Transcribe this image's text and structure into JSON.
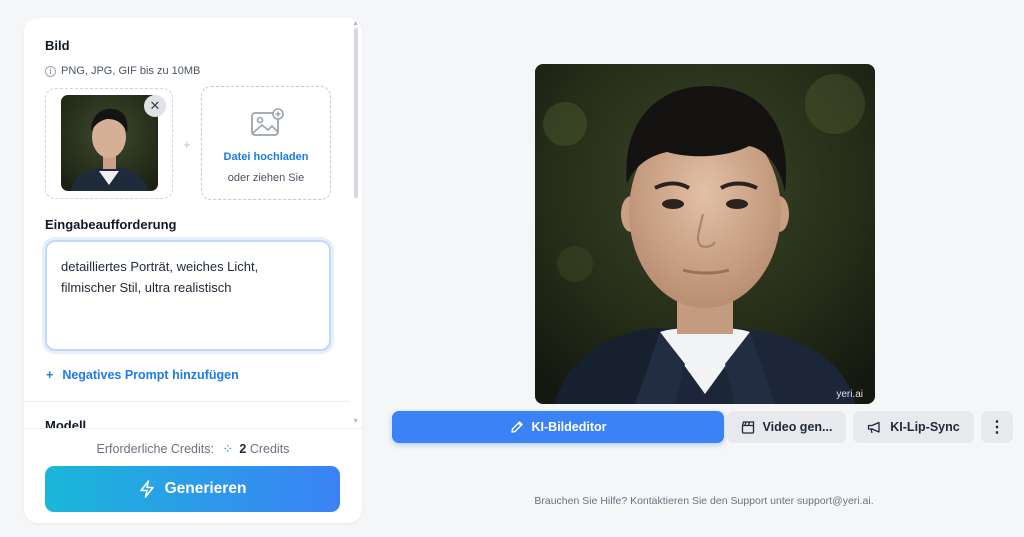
{
  "image_section": {
    "title": "Bild",
    "hint": "PNG, JPG, GIF bis zu 10MB",
    "upload_label": "Datei hochladen",
    "upload_sub": "oder ziehen Sie",
    "separator": "+",
    "remove": "✕"
  },
  "prompt_section": {
    "title": "Eingabeaufforderung",
    "value": "detailliertes Porträt, weiches Licht, filmischer Stil, ultra realistisch",
    "negative_link": "Negatives Prompt hinzufügen",
    "negative_plus": "+"
  },
  "model_section": {
    "title": "Modell"
  },
  "credits": {
    "label": "Erforderliche Credits:",
    "count": "2",
    "unit": "Credits"
  },
  "generate_button": "Generieren",
  "preview": {
    "watermark": "yeri.ai"
  },
  "actions": {
    "editor": "KI-Bildeditor",
    "video": "Video gen...",
    "lipsync": "KI-Lip-Sync",
    "more": "⋮"
  },
  "help_text": "Brauchen Sie Hilfe? Kontaktieren Sie den Support unter support@yeri.ai.",
  "colors": {
    "accent": "#3b82f6",
    "link": "#1d7bea",
    "gradient_start": "#1ab7d9"
  }
}
